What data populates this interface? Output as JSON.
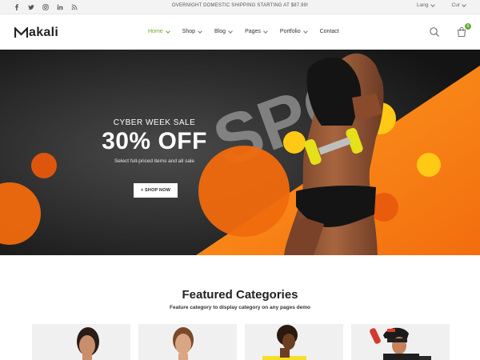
{
  "topbar": {
    "social": [
      "facebook-icon",
      "twitter-icon",
      "instagram-icon",
      "linkedin-icon",
      "rss-icon"
    ],
    "promo": "OVERNIGHT DOMESTIC SHIPPING STARTING AT $87.99!",
    "lang_label": "Lang",
    "currency_label": "Cur"
  },
  "header": {
    "logo_text": "akali",
    "nav": [
      {
        "label": "Home",
        "dropdown": true,
        "active": true
      },
      {
        "label": "Shop",
        "dropdown": true
      },
      {
        "label": "Blog",
        "dropdown": true
      },
      {
        "label": "Pages",
        "dropdown": true
      },
      {
        "label": "Portfolio",
        "dropdown": true
      },
      {
        "label": "Contact",
        "dropdown": false
      }
    ],
    "cart_count": "0"
  },
  "hero": {
    "eyebrow": "CYBER WEEK SALE",
    "headline": "30% OFF",
    "subtext": "Select full-priced items and all sale",
    "cta": "+ SHOP NOW",
    "bg_word": "SPO"
  },
  "featured": {
    "title": "Featured Categories",
    "subtitle": "Feature category to display category on any pages demo"
  },
  "colors": {
    "accent": "#6aaa3a",
    "orange": "#f7941d",
    "hero_dark": "#1d1d1d"
  }
}
